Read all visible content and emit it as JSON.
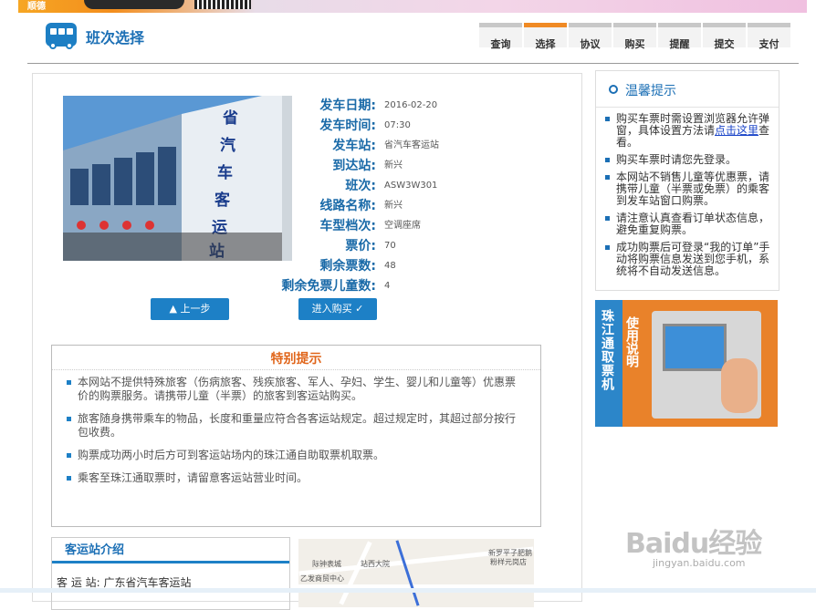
{
  "banner": {
    "brand_text": "顺德"
  },
  "header": {
    "title": "班次选择"
  },
  "steps": [
    {
      "label": "查询",
      "active": false
    },
    {
      "label": "选择",
      "active": true
    },
    {
      "label": "协议",
      "active": false
    },
    {
      "label": "购买",
      "active": false
    },
    {
      "label": "提醒",
      "active": false
    },
    {
      "label": "提交",
      "active": false
    },
    {
      "label": "支付",
      "active": false
    }
  ],
  "trip": {
    "rows": [
      {
        "label": "发车日期:",
        "value": "2016-02-20"
      },
      {
        "label": "发车时间:",
        "value": "07:30"
      },
      {
        "label": "发车站:",
        "value": "省汽车客运站"
      },
      {
        "label": "到达站:",
        "value": "新兴"
      },
      {
        "label": "班次:",
        "value": "ASW3W301"
      },
      {
        "label": "线路名称:",
        "value": "新兴"
      },
      {
        "label": "车型档次:",
        "value": "空调座席"
      },
      {
        "label": "票价:",
        "value": "70"
      },
      {
        "label": "剩余票数:",
        "value": "48"
      },
      {
        "label": "剩余免票儿童数:",
        "value": "4"
      }
    ],
    "photo_sign": "省汽车客运站"
  },
  "buttons": {
    "prev": "▲ 上一步",
    "next": "进入购买 ✓"
  },
  "notice": {
    "title": "特别提示",
    "items": [
      "本网站不提供特殊旅客（伤病旅客、残疾旅客、军人、孕妇、学生、婴儿和儿童等）优惠票价的购票服务。请携带儿童（半票）的旅客到客运站购买。",
      "旅客随身携带乘车的物品，长度和重量应符合各客运站规定。超过规定时，其超过部分按行包收费。",
      "购票成功两小时后方可到客运站场内的珠江通自助取票机取票。",
      "乘客至珠江通取票时，请留意客运站营业时间。"
    ]
  },
  "intro": {
    "title": "客运站介绍",
    "line": "客 运 站: 广东省汽车客运站"
  },
  "map": {
    "labels": [
      "站西大院",
      "际钟表城",
      "乙发商贸中心",
      "新罗平子肥鹅",
      "粉样元岗店"
    ]
  },
  "tips": {
    "title": "温馨提示",
    "item1_before": "购买车票时需设置浏览器允许弹窗，具体设置方法请",
    "item1_link": "点击这里",
    "item1_after": "查看。",
    "item2": "购买车票时请您先登录。",
    "item3": "本网站不销售儿童等优惠票，请携带儿童（半票或免票）的乘客到发车站窗口购票。",
    "item4": "请注意认真查看订单状态信息，避免重复购票。",
    "item5": "成功购票后可登录“我的订单”手动将购票信息发送到您手机，系统将不自动发送信息。"
  },
  "ad": {
    "title_a": "珠江通取票机",
    "title_b": "使用说明"
  },
  "watermark": {
    "logo": "Baidu经验",
    "url": "jingyan.baidu.com"
  },
  "colors": {
    "brand_blue": "#1d80c6",
    "accent_orange": "#f08a24",
    "label_blue": "#1a6aa8"
  }
}
